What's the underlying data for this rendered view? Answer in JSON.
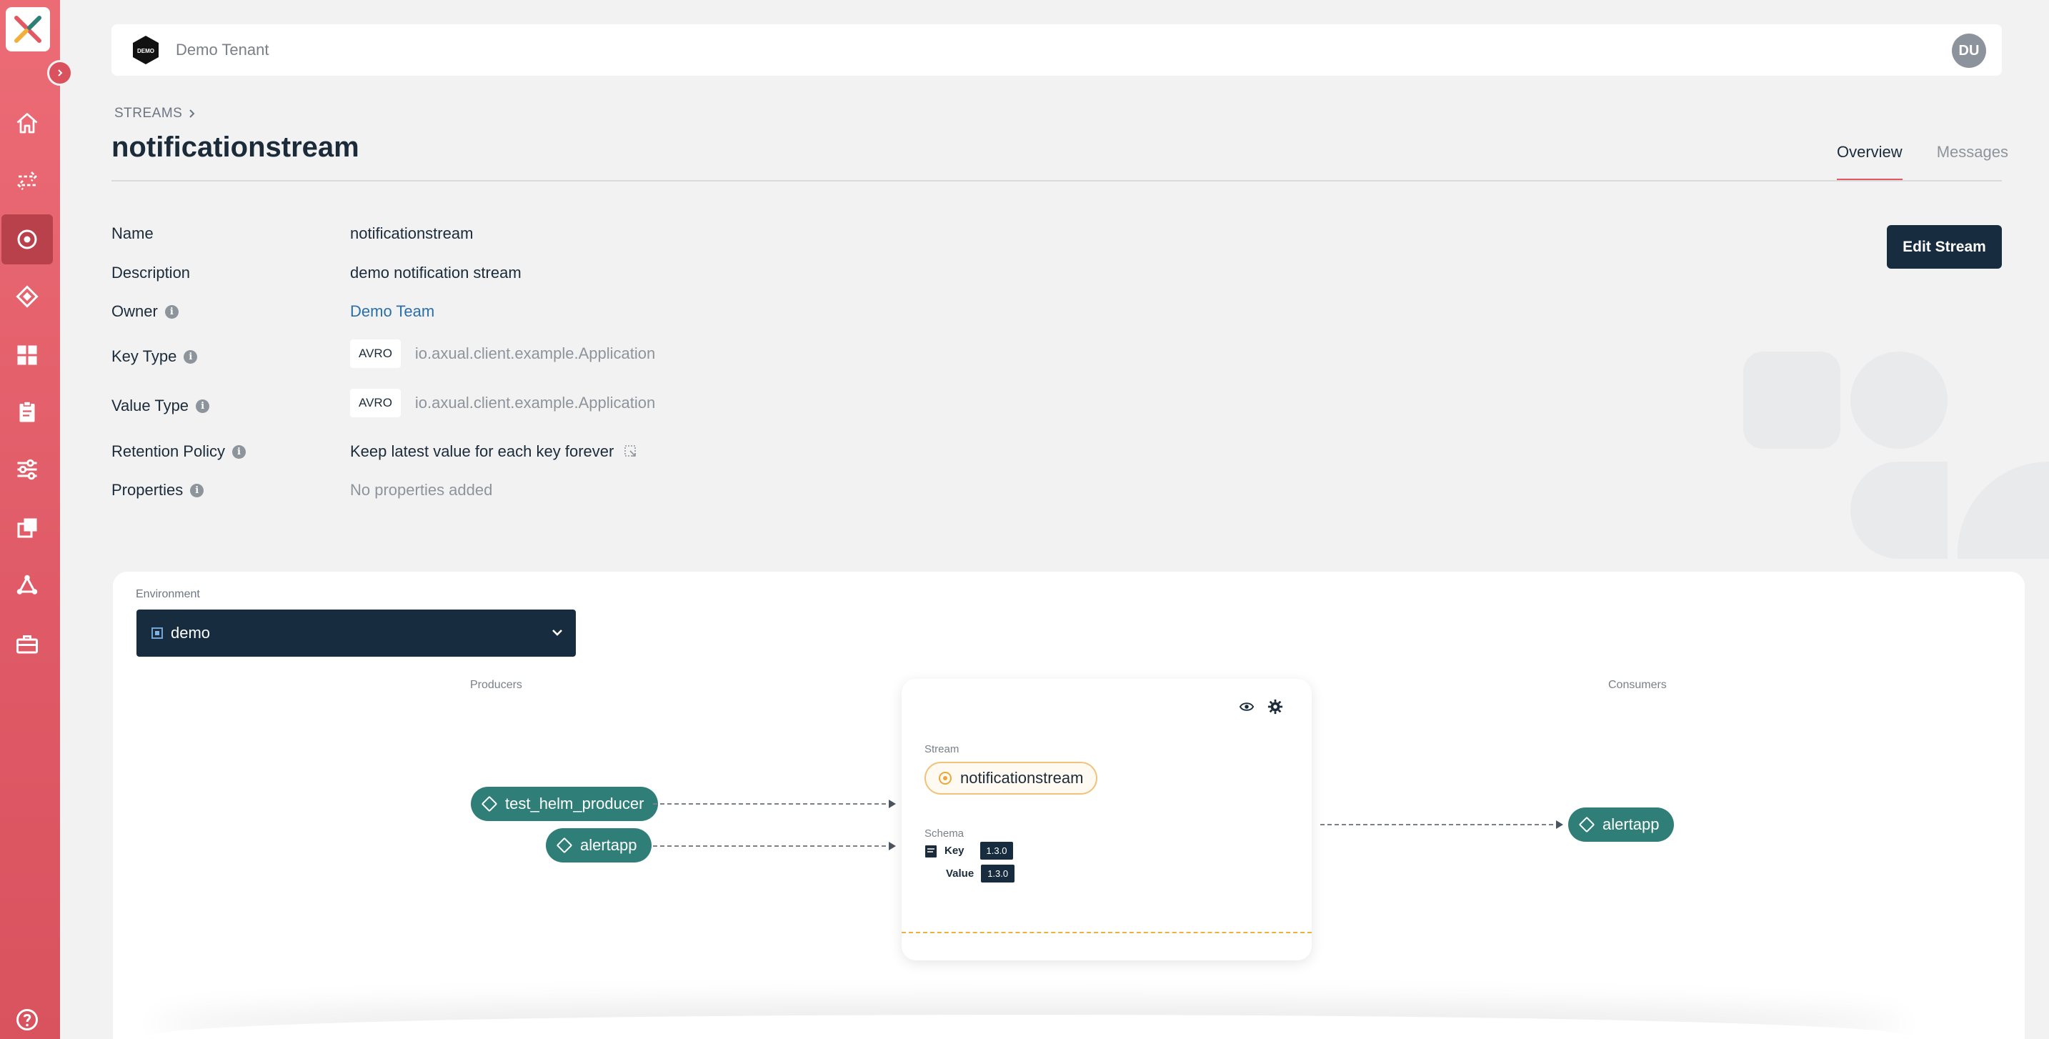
{
  "app": {
    "tenant_name": "Demo Tenant",
    "tenant_logo_text": "DEMO",
    "user_initials": "DU"
  },
  "sidebar": {
    "items": [
      {
        "icon": "home-icon"
      },
      {
        "icon": "apps-arrows-icon"
      },
      {
        "icon": "streams-icon",
        "active": true
      },
      {
        "icon": "applications-icon"
      },
      {
        "icon": "dashboard-icon"
      },
      {
        "icon": "clipboard-icon"
      },
      {
        "icon": "settings-sliders-icon"
      },
      {
        "icon": "copy-icon"
      },
      {
        "icon": "graph-icon"
      },
      {
        "icon": "toolbox-icon"
      },
      {
        "icon": "help-icon"
      }
    ]
  },
  "header": {
    "breadcrumb": "STREAMS",
    "title": "notificationstream",
    "tabs": [
      {
        "label": "Overview",
        "active": true
      },
      {
        "label": "Messages",
        "active": false
      }
    ]
  },
  "details": {
    "edit_label": "Edit Stream",
    "name_label": "Name",
    "name_value": "notificationstream",
    "description_label": "Description",
    "description_value": "demo notification stream",
    "owner_label": "Owner",
    "owner_value": "Demo Team",
    "key_type_label": "Key Type",
    "key_type_badge": "AVRO",
    "key_type_value": "io.axual.client.example.Application",
    "value_type_label": "Value Type",
    "value_type_badge": "AVRO",
    "value_type_value": "io.axual.client.example.Application",
    "retention_label": "Retention Policy",
    "retention_value": "Keep latest value for each key forever",
    "properties_label": "Properties",
    "properties_value": "No properties added"
  },
  "flow": {
    "environment_label": "Environment",
    "environment_value": "demo",
    "producers_label": "Producers",
    "consumers_label": "Consumers",
    "producers": [
      "test_helm_producer",
      "alertapp"
    ],
    "consumers": [
      "alertapp"
    ],
    "stream": {
      "section_label": "Stream",
      "name": "notificationstream",
      "schema_label": "Schema",
      "key_label": "Key",
      "key_version": "1.3.0",
      "value_label": "Value",
      "value_version": "1.3.0"
    }
  },
  "colors": {
    "accent": "#e35763",
    "dark": "#172c3f",
    "teal": "#2f7f78",
    "stream": "#e9a93a"
  }
}
